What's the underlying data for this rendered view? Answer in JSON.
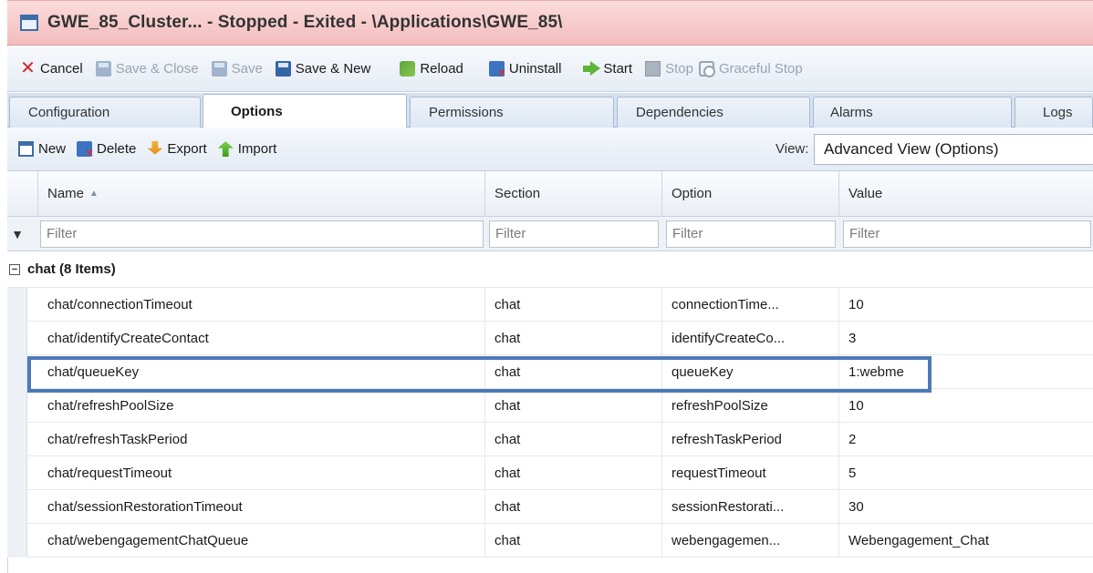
{
  "window": {
    "title": "GWE_85_Cluster... - Stopped - Exited - \\Applications\\GWE_85\\"
  },
  "toolbar": {
    "cancel": "Cancel",
    "save_close": "Save & Close",
    "save": "Save",
    "save_new": "Save & New",
    "reload": "Reload",
    "uninstall": "Uninstall",
    "start": "Start",
    "stop": "Stop",
    "graceful_stop": "Graceful Stop"
  },
  "tabs": [
    "Configuration",
    "Options",
    "Permissions",
    "Dependencies",
    "Alarms",
    "Logs"
  ],
  "active_tab": "Options",
  "subtoolbar": {
    "new": "New",
    "delete": "Delete",
    "export": "Export",
    "import": "Import",
    "view_label": "View:",
    "view_value": "Advanced View (Options)"
  },
  "grid": {
    "columns": [
      "Name",
      "Section",
      "Option",
      "Value"
    ],
    "sorted_column": "Name",
    "filter_placeholder": "Filter",
    "group": {
      "toggle": "⊟",
      "label": "chat (8 Items)"
    },
    "rows": [
      {
        "name": "chat/connectionTimeout",
        "section": "chat",
        "option": "connectionTime...",
        "value": "10"
      },
      {
        "name": "chat/identifyCreateContact",
        "section": "chat",
        "option": "identifyCreateCo...",
        "value": "3"
      },
      {
        "name": "chat/queueKey",
        "section": "chat",
        "option": "queueKey",
        "value": "1:webme"
      },
      {
        "name": "chat/refreshPoolSize",
        "section": "chat",
        "option": "refreshPoolSize",
        "value": "10"
      },
      {
        "name": "chat/refreshTaskPeriod",
        "section": "chat",
        "option": "refreshTaskPeriod",
        "value": "2"
      },
      {
        "name": "chat/requestTimeout",
        "section": "chat",
        "option": "requestTimeout",
        "value": "5"
      },
      {
        "name": "chat/sessionRestorationTimeout",
        "section": "chat",
        "option": "sessionRestorati...",
        "value": "30"
      },
      {
        "name": "chat/webengagementChatQueue",
        "section": "chat",
        "option": "webengagemen...",
        "value": "Webengagement_Chat"
      }
    ],
    "highlighted_row": 2
  },
  "colors": {
    "title_bar": "#f3bcbc",
    "highlight_border": "#4d7ab8",
    "cancel_icon": "#d72525",
    "start_icon": "#5bb536"
  }
}
